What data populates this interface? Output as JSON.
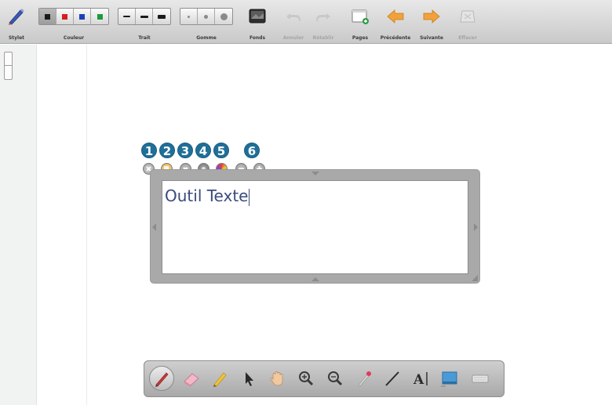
{
  "toolbar": {
    "stylet": {
      "label": "Stylet"
    },
    "couleur": {
      "label": "Couleur",
      "swatches": [
        "#1a1a1a",
        "#d42020",
        "#2040b8",
        "#1d9a3a"
      ]
    },
    "trait": {
      "label": "Trait"
    },
    "gomme": {
      "label": "Gomme"
    },
    "fonds": {
      "label": "Fonds"
    },
    "annuler": {
      "label": "Annuler",
      "enabled": false
    },
    "retablir": {
      "label": "Rétablir",
      "enabled": false
    },
    "pages": {
      "label": "Pages"
    },
    "precedente": {
      "label": "Précédente"
    },
    "suivante": {
      "label": "Suivante"
    },
    "effacer": {
      "label": "Effacer",
      "enabled": false
    }
  },
  "badges": [
    "1",
    "2",
    "3",
    "4",
    "5",
    "6"
  ],
  "textbox": {
    "text": "Outil Texte"
  },
  "bottom_tools": [
    {
      "icon": "pen-icon",
      "active": true
    },
    {
      "icon": "eraser-icon"
    },
    {
      "icon": "highlighter-icon"
    },
    {
      "icon": "pointer-icon"
    },
    {
      "icon": "hand-icon"
    },
    {
      "icon": "zoom-in-icon"
    },
    {
      "icon": "zoom-out-icon"
    },
    {
      "icon": "laser-pointer-icon"
    },
    {
      "icon": "line-icon"
    },
    {
      "icon": "text-tool-icon",
      "glyph": "A"
    },
    {
      "icon": "capture-icon"
    },
    {
      "icon": "keyboard-icon"
    }
  ],
  "colors": {
    "accent_blue": "#1f6f98",
    "text_blue": "#3a4a7c",
    "orange": "#f2a23a"
  }
}
